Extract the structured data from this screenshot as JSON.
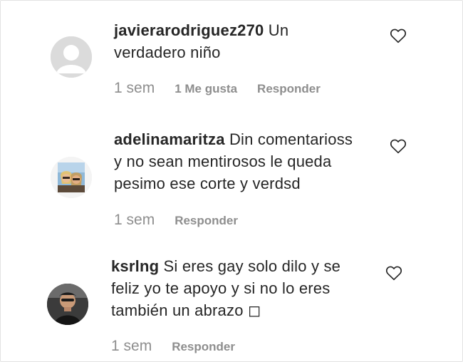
{
  "comments": [
    {
      "username": "javierarodriguez270",
      "line1": " Un",
      "line2": "verdadero niño",
      "time": "1 sem",
      "likes": "1 Me gusta",
      "reply": "Responder",
      "avatar": "default-avatar"
    },
    {
      "username": "adelinamaritza",
      "line1": " Din comentarioss",
      "line2": "y no sean mentirosos le queda",
      "line3": "pesimo ese corte y verdsd",
      "time": "1 sem",
      "reply": "Responder",
      "avatar": "photo-avatar"
    },
    {
      "username": "ksrlng",
      "line1": " Si eres gay solo dilo y se",
      "line2": "feliz yo te apoyo y si no lo eres",
      "line3": "también un abrazo ◻",
      "time": "1 sem",
      "reply": "Responder",
      "avatar": "photo-avatar"
    }
  ],
  "colors": {
    "text": "#262626",
    "secondary": "#8e8e8e",
    "border": "#e3e3e3"
  }
}
